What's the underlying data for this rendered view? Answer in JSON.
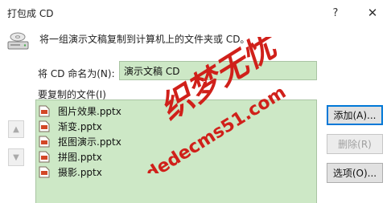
{
  "window": {
    "title": "打包成 CD",
    "help_symbol": "?",
    "close_symbol": "✕"
  },
  "header": {
    "intro_text": "将一组演示文稿复制到计算机上的文件夹或 CD。",
    "icon": "cd-drive-icon"
  },
  "name_field": {
    "label": "将 CD 命名为(N):",
    "value": "演示文稿 CD"
  },
  "files": {
    "label": "要复制的文件(I)",
    "items": [
      {
        "name": "图片效果.pptx",
        "icon": "pptx-file-icon"
      },
      {
        "name": "渐变.pptx",
        "icon": "pptx-file-icon"
      },
      {
        "name": "抠图演示.pptx",
        "icon": "pptx-file-icon"
      },
      {
        "name": "拼图.pptx",
        "icon": "pptx-file-icon"
      },
      {
        "name": "摄影.pptx",
        "icon": "pptx-file-icon"
      }
    ]
  },
  "order_buttons": {
    "up_symbol": "▲",
    "down_symbol": "▼"
  },
  "buttons": {
    "add": "添加(A)...",
    "remove": "删除(R)",
    "options": "选项(O)..."
  },
  "watermark": {
    "line1": "织梦无忧",
    "line2": "dedecms51.com",
    "color": "#d0201a"
  },
  "colors": {
    "field_background": "#cde8c6",
    "focus_border": "#0078d7"
  }
}
